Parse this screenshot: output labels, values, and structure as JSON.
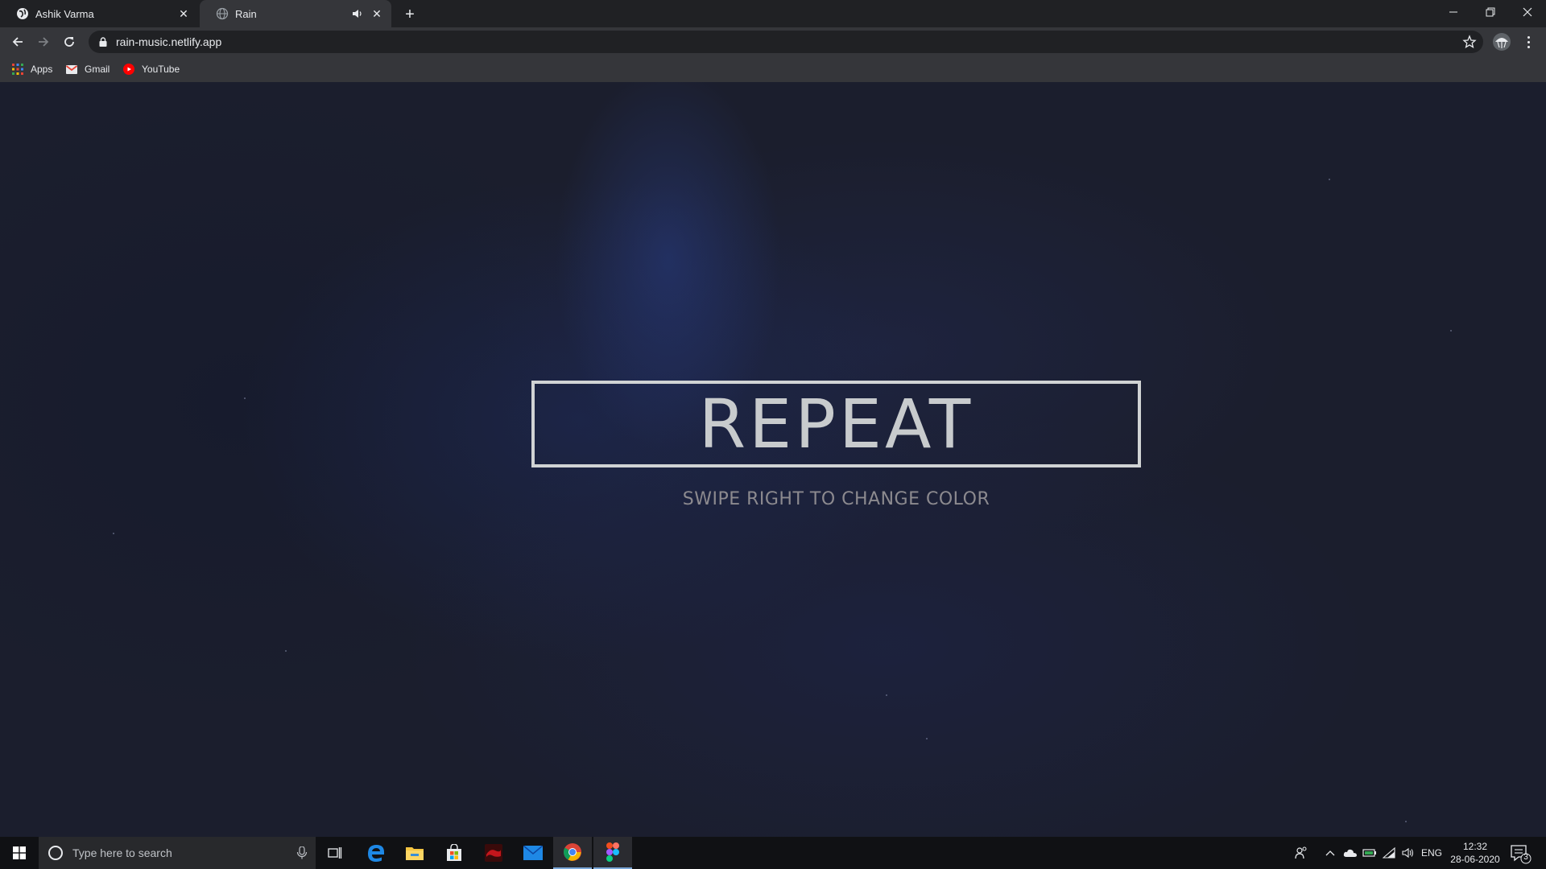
{
  "browser": {
    "tabs": [
      {
        "title": "Ashik Varma",
        "active": false
      },
      {
        "title": "Rain",
        "active": true
      }
    ],
    "url": "rain-music.netlify.app",
    "bookmarks": [
      {
        "label": "Apps",
        "icon": "apps-grid-icon"
      },
      {
        "label": "Gmail",
        "icon": "gmail-icon"
      },
      {
        "label": "YouTube",
        "icon": "youtube-icon"
      }
    ]
  },
  "page": {
    "button_text": "REPEAT",
    "subtitle": "SWIPE RIGHT TO CHANGE COLOR"
  },
  "taskbar": {
    "search_placeholder": "Type here to search",
    "language": "ENG",
    "time": "12:32",
    "date": "28-06-2020",
    "notification_count": "3"
  },
  "colors": {
    "background": "#1b1e2d",
    "box_border": "#d0d3d4",
    "subtitle": "#8c8a8f"
  }
}
